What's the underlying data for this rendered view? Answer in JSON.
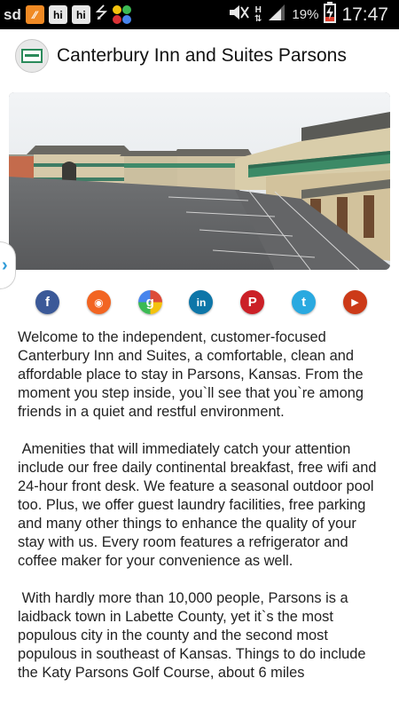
{
  "status_bar": {
    "left_text": "sd",
    "notif_box1": "",
    "notif_box2": "hi",
    "notif_box3": "hi",
    "network_label": "H",
    "battery_percent": "19%",
    "time": "17:47"
  },
  "header": {
    "title": "Canterbury Inn and Suites Parsons"
  },
  "social_icons": [
    {
      "icon": "facebook-icon",
      "glyph": "f",
      "color": "#3b5998"
    },
    {
      "icon": "rss-icon",
      "glyph": "◉",
      "color": "#f26522"
    },
    {
      "icon": "google-plus-icon",
      "glyph": "g",
      "color": "#dd4b39"
    },
    {
      "icon": "linkedin-icon",
      "glyph": "in",
      "color": "#0e76a8"
    },
    {
      "icon": "pinterest-icon",
      "glyph": "P",
      "color": "#cb2027"
    },
    {
      "icon": "twitter-icon",
      "glyph": "t",
      "color": "#2aa9e0"
    },
    {
      "icon": "youtube-icon",
      "glyph": "▶",
      "color": "#cc3a18"
    }
  ],
  "content": {
    "paragraph1": "Welcome to the independent, customer-focused Canterbury Inn and Suites, a comfortable, clean and affordable place to stay in Parsons, Kansas. From the moment you step inside, you`ll see that you`re among friends in a quiet and restful environment.",
    "paragraph2": " Amenities that will immediately catch your attention include our free daily continental breakfast, free wifi and 24-hour front desk. We feature a seasonal outdoor pool too. Plus, we offer guest laundry facilities, free parking and many other things to enhance the quality of your stay with us. Every room features a refrigerator and coffee maker for your convenience as well.",
    "paragraph3": " With hardly more than 10,000 people, Parsons is a laidback town in Labette County, yet it`s the most populous city in the county and the second most populous in southeast of Kansas. Things to do include the Katy Parsons Golf Course, about 6 miles"
  }
}
